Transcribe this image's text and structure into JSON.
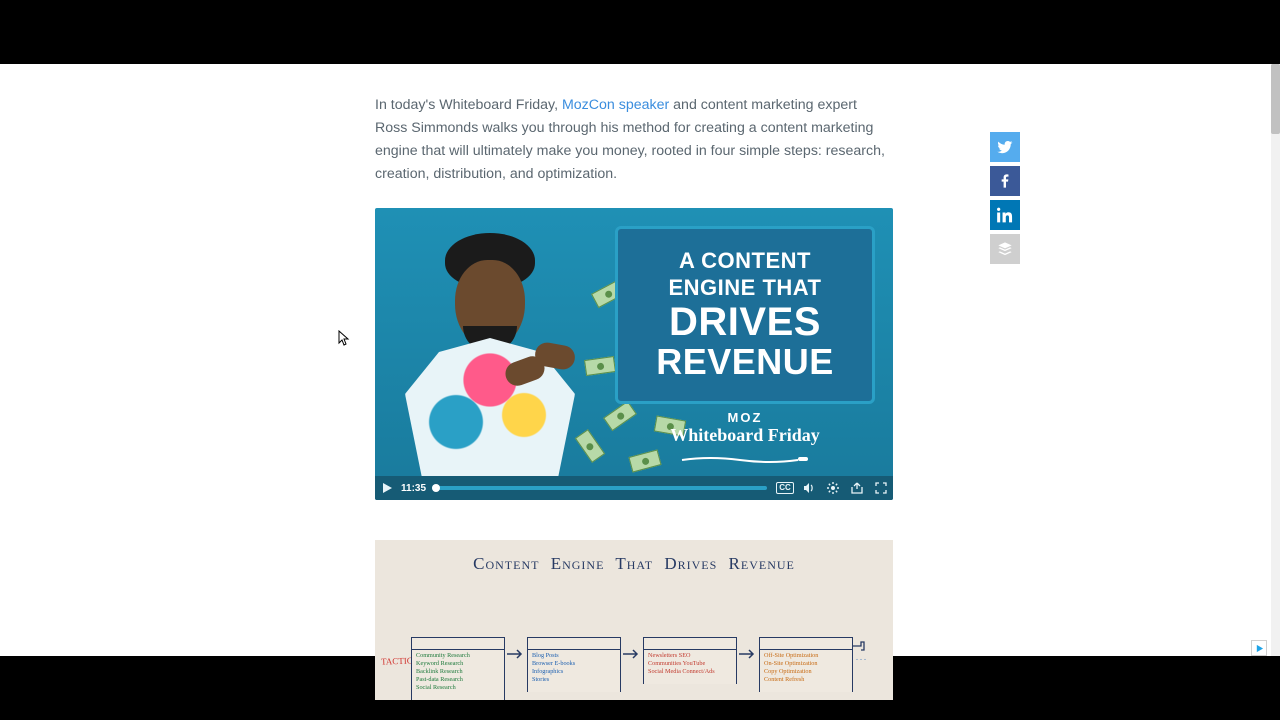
{
  "intro": {
    "before_link": "In today's Whiteboard Friday, ",
    "link_text": "MozCon speaker",
    "after_link": " and content marketing expert Ross Simmonds walks you through his method for creating a content marketing engine that will ultimately make you money, rooted in four simple steps: research, creation, distribution, and optimization."
  },
  "video": {
    "title_card": {
      "line1": "A CONTENT",
      "line2": "ENGINE THAT",
      "line3": "DRIVES",
      "line4": "REVENUE"
    },
    "brand": {
      "logo": "MOZ",
      "text": "Whiteboard Friday"
    },
    "controls": {
      "duration": "11:35",
      "cc_label": "CC"
    }
  },
  "whiteboard": {
    "title": "Content  Engine  That  Drives  Revenue",
    "row_label": "TACTICS",
    "boxes": [
      {
        "color": "green",
        "items": [
          "Community Research",
          "Keyword Research",
          "Backlink Research",
          "Past-data Research",
          "Social Research"
        ]
      },
      {
        "color": "blue",
        "items": [
          "Blog Posts",
          "Browser E-books",
          "Infographics",
          "Stories"
        ]
      },
      {
        "color": "red",
        "items": [
          "Newsletters   SEO",
          "Communities   YouTube",
          "Social Media   Connect/Ads"
        ]
      },
      {
        "color": "orange",
        "items": [
          "Off-Site Optimization",
          "On-Site Optimization",
          "Copy Optimization",
          "Content Refresh"
        ]
      }
    ]
  },
  "social": {
    "twitter": "twitter-share",
    "facebook": "facebook-share",
    "linkedin": "linkedin-share",
    "buffer": "buffer-share"
  }
}
